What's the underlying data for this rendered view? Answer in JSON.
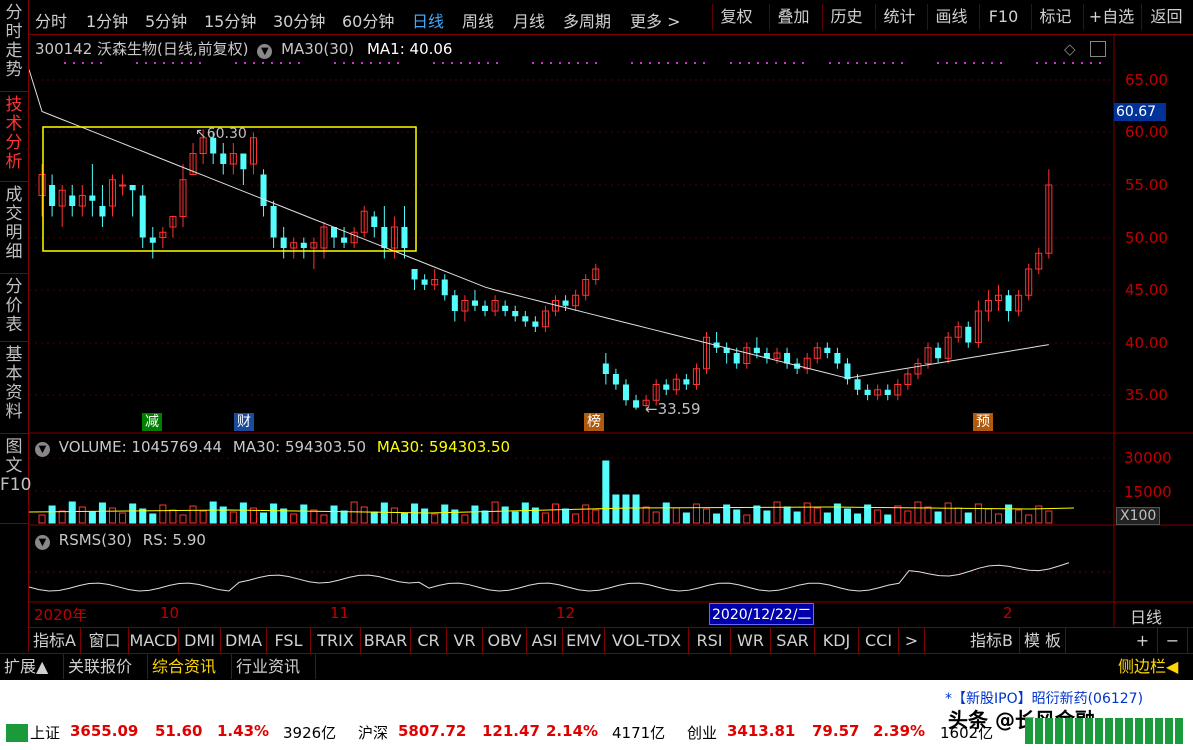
{
  "sidebar": {
    "tabs": [
      {
        "label": "分时走势",
        "active": false
      },
      {
        "label": "技术分析",
        "active": true
      },
      {
        "label": "成交明细",
        "active": false
      },
      {
        "label": "分价表",
        "active": false
      },
      {
        "label": "基本资料",
        "active": false
      },
      {
        "label": "图文F10",
        "active": false
      }
    ]
  },
  "toolbar": {
    "periods": [
      "分时",
      "1分钟",
      "5分钟",
      "15分钟",
      "30分钟",
      "60分钟",
      "日线",
      "周线",
      "月线",
      "多周期",
      "更多 >"
    ],
    "active_period": "日线",
    "buttons": [
      "复权",
      "叠加",
      "历史",
      "统计",
      "画线",
      "F10",
      "标记",
      "+自选",
      "返回"
    ]
  },
  "price_panel": {
    "title": "300142 沃森生物(日线,前复权)",
    "ma_label": "MA30(30)",
    "ma_value": "MA1: 40.06",
    "current_price": "60.67",
    "high_label": "60.30",
    "low_label": "←33.59",
    "y_ticks": [
      "65.00",
      "60.00",
      "55.00",
      "50.00",
      "45.00",
      "40.00",
      "35.00"
    ],
    "markers": [
      {
        "text": "减",
        "color": "#00a000"
      },
      {
        "text": "财",
        "color": "#2060c0"
      },
      {
        "text": "榜",
        "color": "#c06000"
      },
      {
        "text": "预",
        "color": "#c06000"
      }
    ]
  },
  "volume_panel": {
    "title": "VOLUME: 1045769.44",
    "ma1": "MA30: 594303.50",
    "ma2": "MA30: 594303.50",
    "y_ticks": [
      "30000",
      "15000"
    ],
    "unit": "X100"
  },
  "rsms_panel": {
    "title": "RSMS(30)",
    "value": "RS: 5.90"
  },
  "date_axis": {
    "labels": [
      "2020年",
      "10",
      "11",
      "12",
      "2"
    ],
    "cursor_date": "2020/12/22/二",
    "period_label": "日线"
  },
  "indicator_tabs": [
    "指标A",
    "窗口",
    "MACD",
    "DMI",
    "DMA",
    "FSL",
    "TRIX",
    "BRAR",
    "CR",
    "VR",
    "OBV",
    "ASI",
    "EMV",
    "VOL-TDX",
    "RSI",
    "WR",
    "SAR",
    "KDJ",
    "CCI",
    ">",
    "指标B",
    "模 板",
    "+",
    "−"
  ],
  "ext_tabs": [
    "扩展▲",
    "关联报价",
    "综合资讯",
    "行业资讯"
  ],
  "side_bar_label": "侧边栏◀",
  "news": "*【新股IPO】昭衍新药(06127)",
  "watermark": "头条 @长风金融",
  "tickers": [
    {
      "name": "上证",
      "price": "3655.09",
      "change": "51.60",
      "pct": "1.43%",
      "amount": "3926亿"
    },
    {
      "name": "沪深",
      "price": "5807.72",
      "change": "121.47",
      "pct": "2.14%",
      "amount": "4171亿"
    },
    {
      "name": "创业",
      "price": "3413.81",
      "change": "79.57",
      "pct": "2.39%",
      "amount": "1602亿"
    }
  ]
}
